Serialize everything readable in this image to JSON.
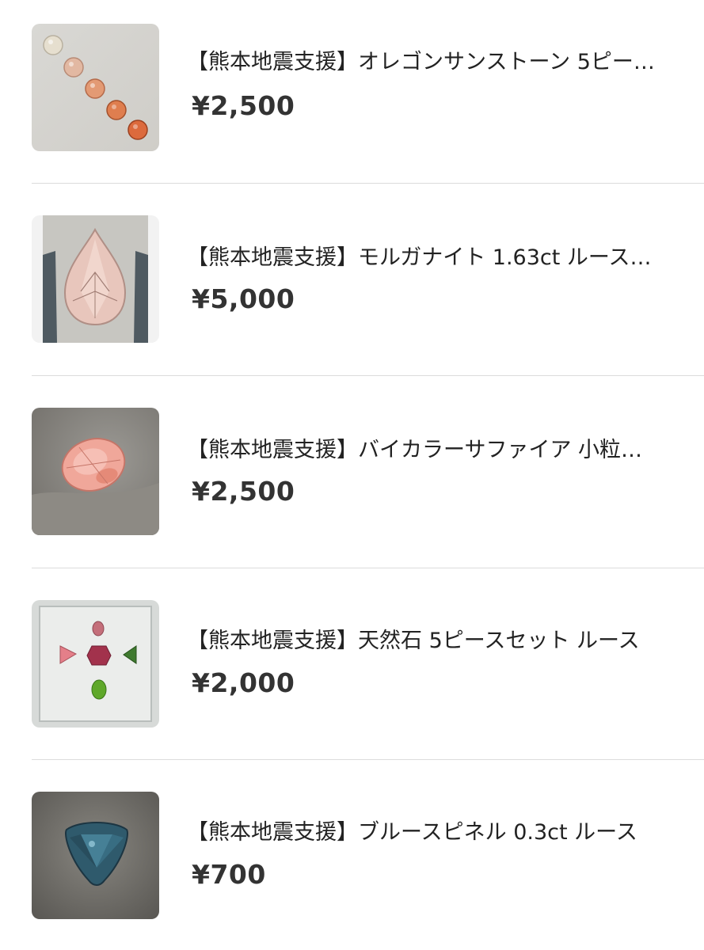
{
  "products": [
    {
      "title": "【熊本地震支援】オレゴンサンストーン 5ピー…",
      "price": "¥2,500",
      "image": "oregon-sunstone-five-pieces"
    },
    {
      "title": "【熊本地震支援】モルガナイト 1.63ct ルース…",
      "price": "¥5,000",
      "image": "morganite-pear-in-tweezers"
    },
    {
      "title": "【熊本地震支援】バイカラーサファイア 小粒…",
      "price": "¥2,500",
      "image": "bicolor-sapphire-oval-on-felt"
    },
    {
      "title": "【熊本地震支援】天然石 5ピースセット ルース",
      "price": "¥2,000",
      "image": "five-stone-set-in-box"
    },
    {
      "title": "【熊本地震支援】ブルースピネル 0.3ct ルース",
      "price": "¥700",
      "image": "blue-spinel-trillion"
    }
  ]
}
